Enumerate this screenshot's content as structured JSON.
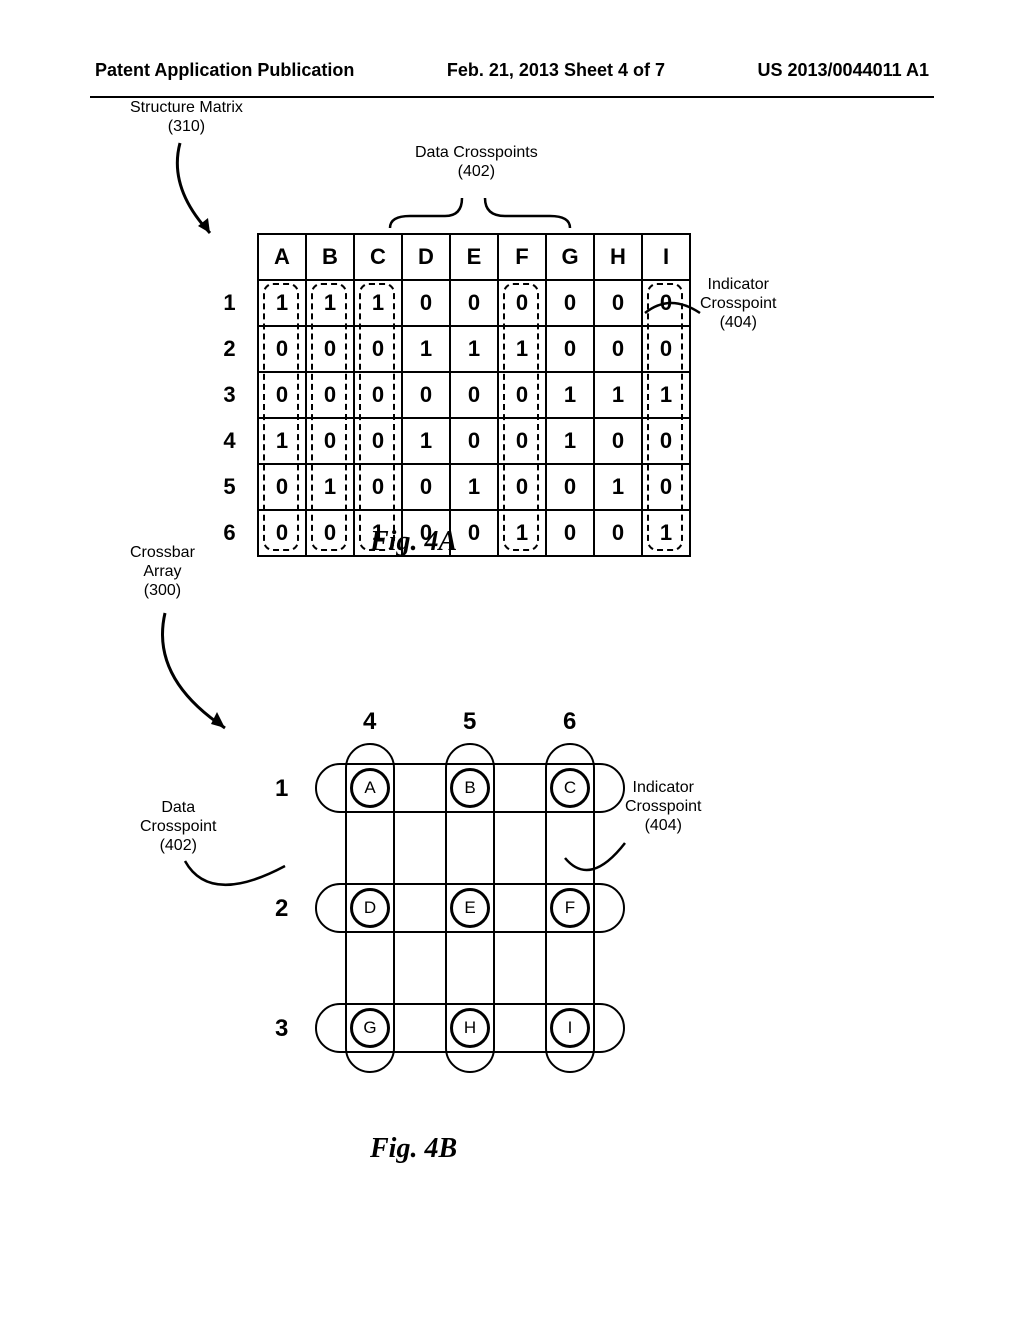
{
  "header": {
    "left": "Patent Application Publication",
    "center": "Feb. 21, 2013  Sheet 4 of 7",
    "right": "US 2013/0044011 A1"
  },
  "labels": {
    "structure_matrix": "Structure Matrix",
    "structure_matrix_ref": "(310)",
    "data_crosspoints": "Data Crosspoints",
    "data_crosspoints_ref": "(402)",
    "indicator_crosspoint": "Indicator",
    "indicator_crosspoint2": "Crosspoint",
    "indicator_crosspoint_ref": "(404)",
    "crossbar_array": "Crossbar",
    "crossbar_array2": "Array",
    "crossbar_array_ref": "(300)",
    "data_crosspoint_b": "Data",
    "data_crosspoint_b2": "Crosspoint",
    "data_crosspoint_b_ref": "(402)"
  },
  "figures": {
    "fig4a": "Fig. 4A",
    "fig4b": "Fig. 4B"
  },
  "chart_data": {
    "matrix": {
      "type": "table",
      "title": "Structure Matrix (310)",
      "columns": [
        "A",
        "B",
        "C",
        "D",
        "E",
        "F",
        "G",
        "H",
        "I"
      ],
      "rows": [
        "1",
        "2",
        "3",
        "4",
        "5",
        "6"
      ],
      "values": [
        [
          1,
          1,
          1,
          0,
          0,
          0,
          0,
          0,
          0
        ],
        [
          0,
          0,
          0,
          1,
          1,
          1,
          0,
          0,
          0
        ],
        [
          0,
          0,
          0,
          0,
          0,
          0,
          1,
          1,
          1
        ],
        [
          1,
          0,
          0,
          1,
          0,
          0,
          1,
          0,
          0
        ],
        [
          0,
          1,
          0,
          0,
          1,
          0,
          0,
          1,
          0
        ],
        [
          0,
          0,
          1,
          0,
          0,
          1,
          0,
          0,
          1
        ]
      ],
      "indicator_columns": [
        "A",
        "B",
        "C",
        "F",
        "I"
      ]
    },
    "crossbar": {
      "type": "diagram",
      "title": "Crossbar Array (300)",
      "col_labels": [
        "4",
        "5",
        "6"
      ],
      "row_labels": [
        "1",
        "2",
        "3"
      ],
      "nodes": [
        [
          "A",
          "B",
          "C"
        ],
        [
          "D",
          "E",
          "F"
        ],
        [
          "G",
          "H",
          "I"
        ]
      ]
    }
  }
}
